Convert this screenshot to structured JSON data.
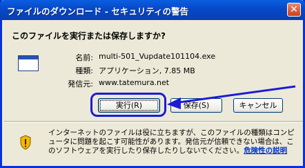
{
  "window": {
    "title": "ファイルのダウンロード - セキュリティの警告",
    "close_glyph": "✕"
  },
  "prompt": {
    "question": "このファイルを実行または保存しますか?"
  },
  "file_info": {
    "name_label": "名前:",
    "name_value": "multi-501_Vupdate101104.exe",
    "type_label": "種類:",
    "type_value": "アプリケーション, 7.85 MB",
    "source_label": "発信元:",
    "source_value": "www.tatemura.net"
  },
  "buttons": {
    "run": "実行(R)",
    "save": "保存(S)",
    "cancel": "キャンセル"
  },
  "warning": {
    "text": "インターネットのファイルは役に立ちますが、このファイルの種類はコンピュータに問題を起こす可能性があります。発信元が信頼できない場合は、このソフトウェアを実行したり保存したりしないでください。",
    "link": "危険性の説明"
  },
  "colors": {
    "titlebar": "#0a5fe0",
    "dialog_bg": "#ece9d8",
    "annotation": "#1b1bd6"
  }
}
